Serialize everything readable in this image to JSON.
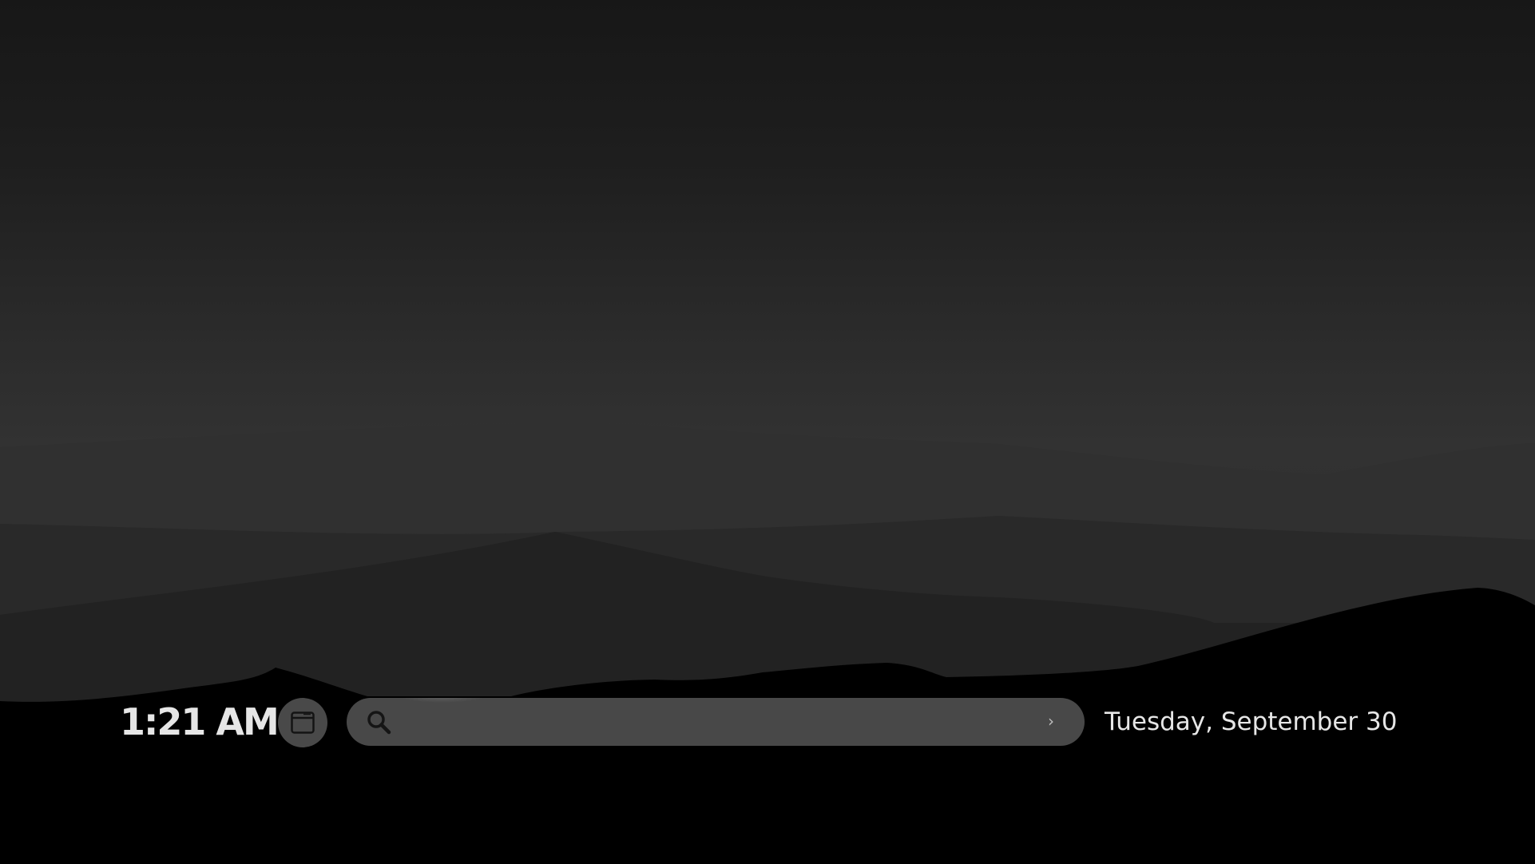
{
  "clock": {
    "time": "1:21 AM"
  },
  "search": {
    "placeholder": "",
    "value": "",
    "go_glyph": "›"
  },
  "date": {
    "text": "Tuesday, September 30"
  },
  "icons": {
    "window": "window-icon",
    "search": "search-icon",
    "go": "chevron-right-icon"
  },
  "colors": {
    "sky_top": "#171717",
    "sky_horizon": "#323232",
    "ground": "#000000",
    "search_bar": "#484848",
    "text": "#e6e6e6"
  }
}
